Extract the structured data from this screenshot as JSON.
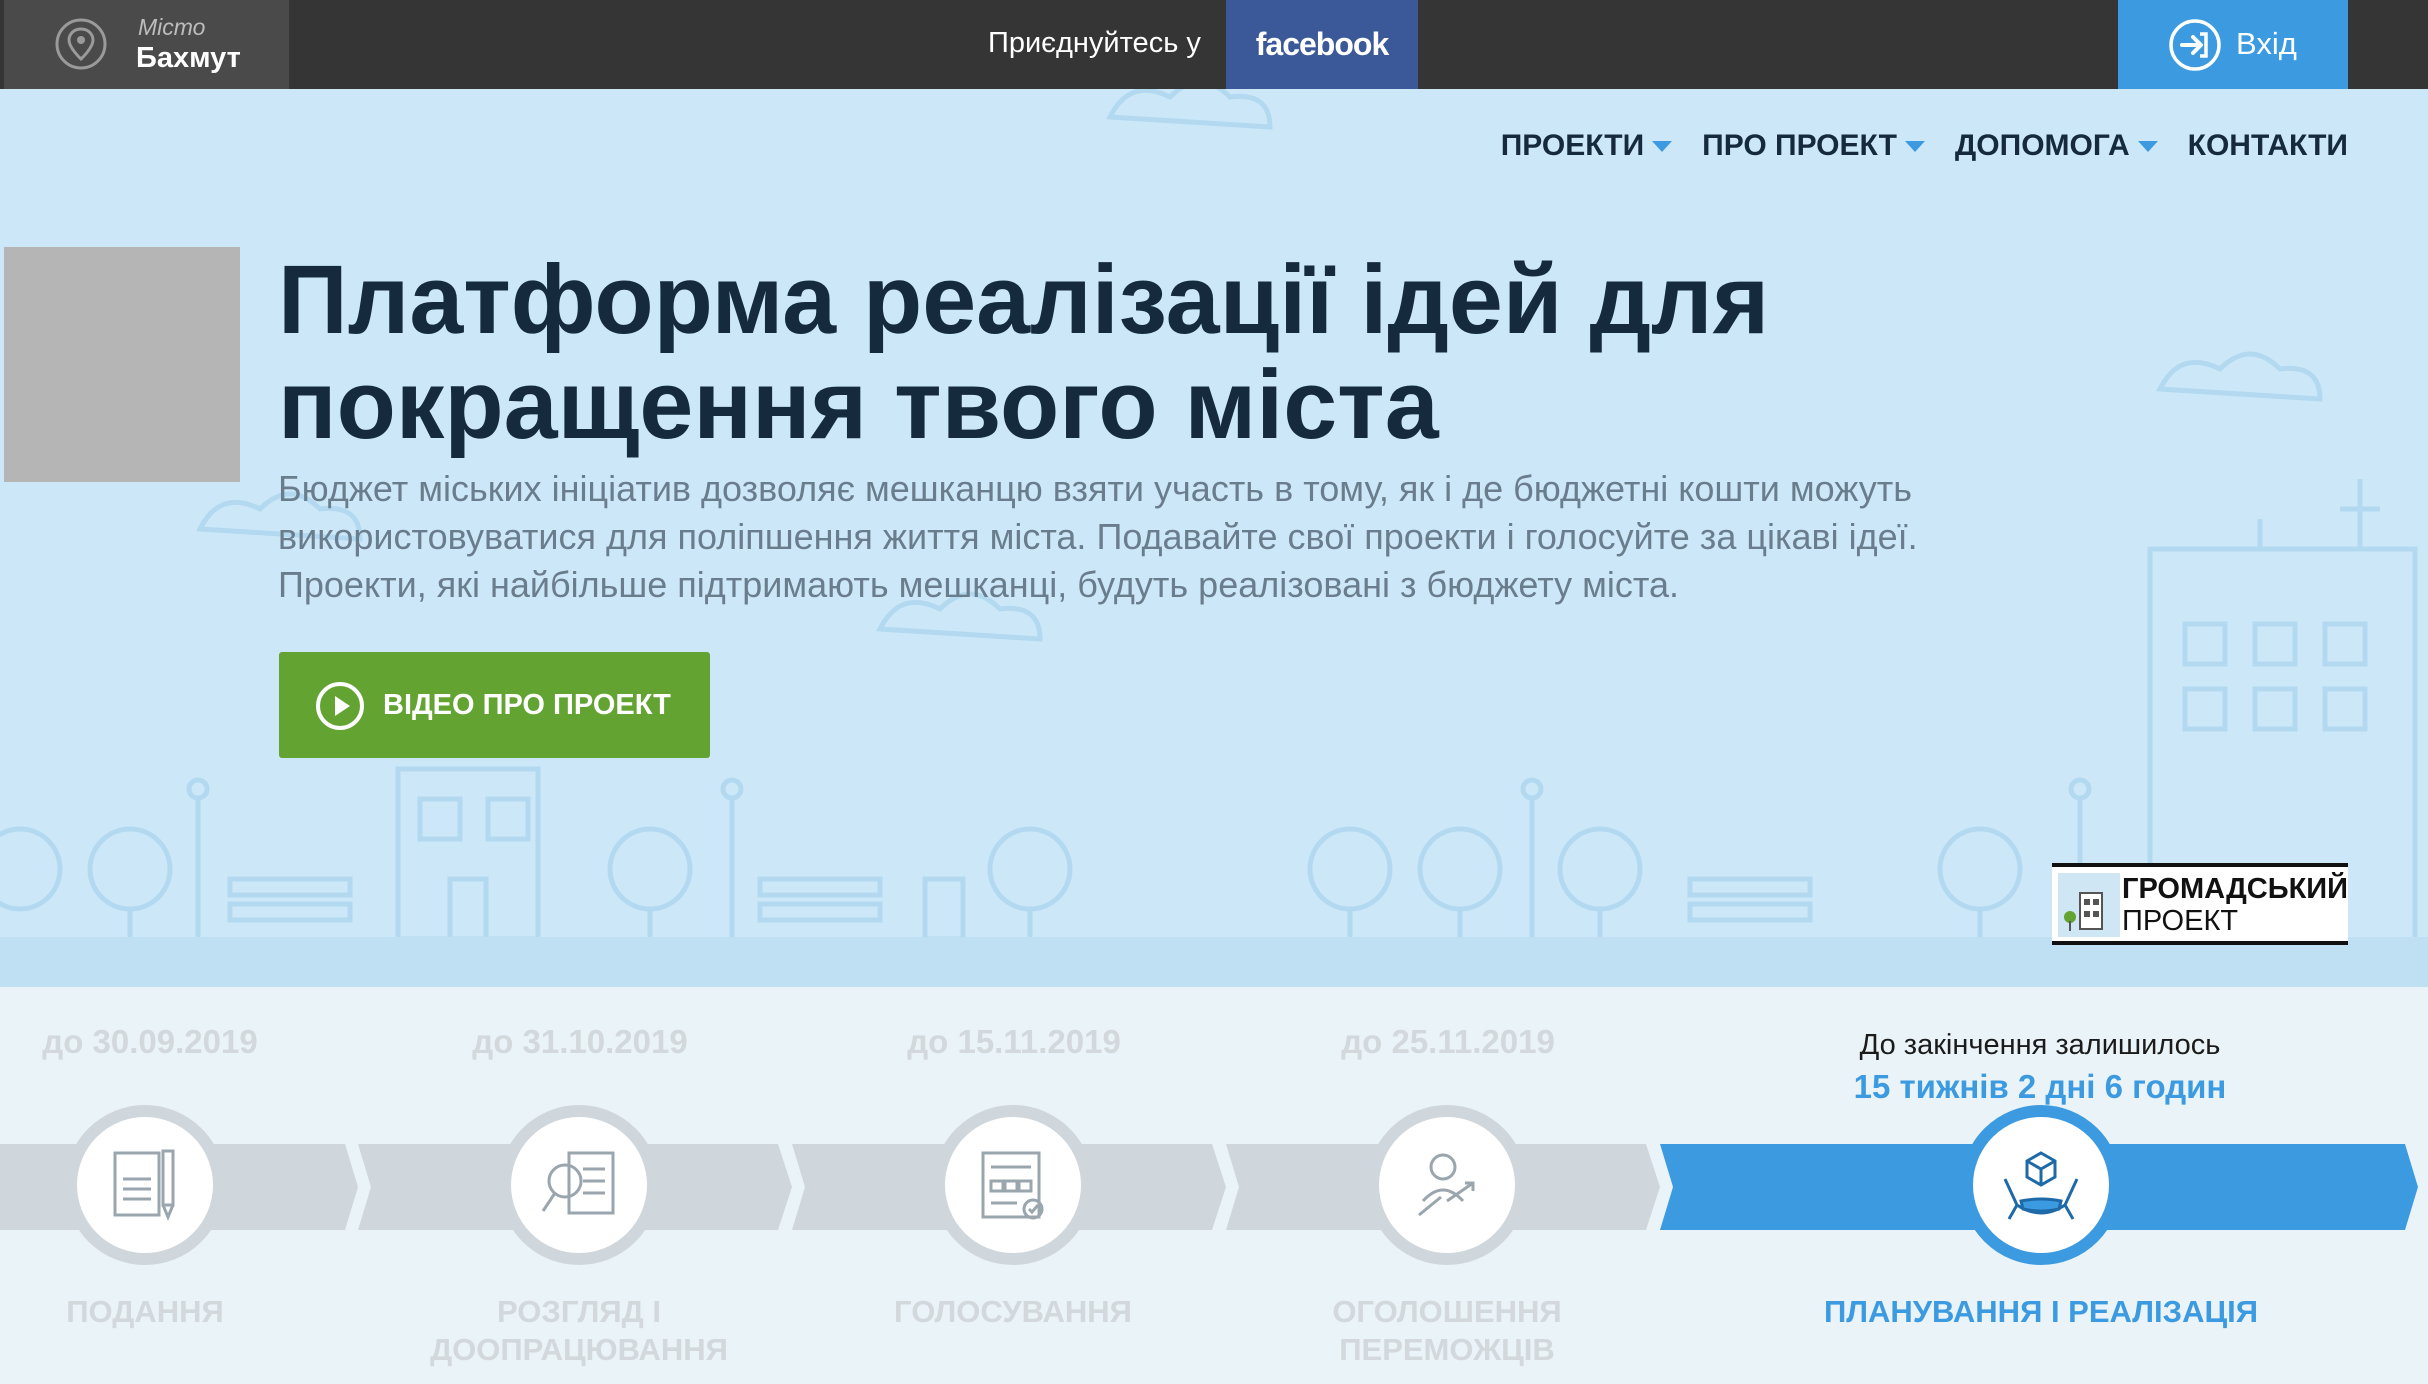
{
  "header": {
    "city_label": "Місто",
    "city_name": "Бахмут",
    "join_text": "Приєднуйтесь у",
    "facebook_label": "facebook",
    "login_label": "Вхід"
  },
  "nav": {
    "items": [
      {
        "label": "ПРОЕКТИ",
        "has_dropdown": true
      },
      {
        "label": "ПРО ПРОЕКТ",
        "has_dropdown": true
      },
      {
        "label": "ДОПОМОГА",
        "has_dropdown": true
      },
      {
        "label": "КОНТАКТИ",
        "has_dropdown": false
      }
    ]
  },
  "hero": {
    "title_line1": "Платформа реалізації ідей для",
    "title_line2": "покращення твого міста",
    "desc_line1": "Бюджет міських ініціатив дозволяє мешканцю взяти участь в тому, як і де бюджетні кошти можуть",
    "desc_line2": "використовуватися для поліпшення життя міста. Подавайте свої проекти і голосуйте за цікаві ідеї.",
    "desc_line3": "Проекти, які найбільше підтримають мешканці, будуть реалізовані з бюджету міста.",
    "video_button": "ВІДЕО ПРО ПРОЕКТ",
    "logo_line1": "ГРОМАДСЬКИЙ",
    "logo_line2": "ПРОЕКТ"
  },
  "timeline": {
    "stages": [
      {
        "date": "до 30.09.2019",
        "label_line1": "ПОДАННЯ",
        "label_line2": "",
        "active": false,
        "icon": "document-pen-icon"
      },
      {
        "date": "до 31.10.2019",
        "label_line1": "РОЗГЛЯД І",
        "label_line2": "ДООПРАЦЮВАННЯ",
        "active": false,
        "icon": "magnifier-document-icon"
      },
      {
        "date": "до 15.11.2019",
        "label_line1": "ГОЛОСУВАННЯ",
        "label_line2": "",
        "active": false,
        "icon": "ballot-icon"
      },
      {
        "date": "до 25.11.2019",
        "label_line1": "ОГОЛОШЕННЯ",
        "label_line2": "ПЕРЕМОЖЦІВ",
        "active": false,
        "icon": "winner-person-icon"
      },
      {
        "date": "",
        "label_line1": "ПЛАНУВАННЯ І РЕАЛІЗАЦІЯ",
        "label_line2": "",
        "active": true,
        "icon": "hands-cube-icon"
      }
    ],
    "remaining_label": "До закінчення залишилось",
    "remaining_value": "15 тижнів 2 дні 6 годин"
  },
  "colors": {
    "topbar": "#353535",
    "facebook": "#3b5998",
    "login": "#3c9be0",
    "hero_bg": "#cce8f8",
    "green_button": "#62a332",
    "active_blue": "#3c9be0",
    "inactive_gray": "#d0d7dc"
  }
}
